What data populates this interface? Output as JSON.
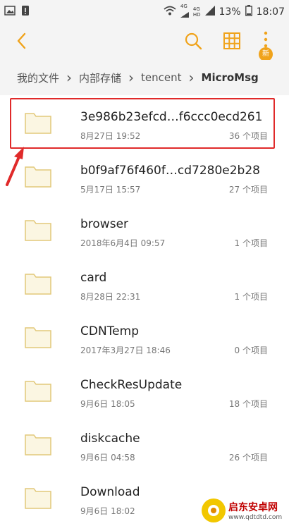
{
  "statusbar": {
    "net_type": "4G",
    "net_sub1": "4G",
    "net_sub2": "HD",
    "battery": "13%",
    "time": "18:07"
  },
  "appbar": {
    "new_badge": "新",
    "accent": "#f0a31b"
  },
  "breadcrumb": {
    "items": [
      "我的文件",
      "内部存储",
      "tencent",
      "MicroMsg"
    ]
  },
  "folders": [
    {
      "name": "3e986b23efcd…f6ccc0ecd261",
      "date": "8月27日 19:52",
      "count": "36 个项目"
    },
    {
      "name": "b0f9af76f460f…cd7280e2b28",
      "date": "5月17日 15:57",
      "count": "27 个项目"
    },
    {
      "name": "browser",
      "date": "2018年6月4日 09:57",
      "count": "1 个项目"
    },
    {
      "name": "card",
      "date": "8月28日 22:31",
      "count": "1 个项目"
    },
    {
      "name": "CDNTemp",
      "date": "2017年3月27日 18:46",
      "count": "0 个项目"
    },
    {
      "name": "CheckResUpdate",
      "date": "9月6日 18:05",
      "count": "18 个项目"
    },
    {
      "name": "diskcache",
      "date": "9月6日 04:58",
      "count": "26 个项目"
    },
    {
      "name": "Download",
      "date": "9月6日 18:02",
      "count": ""
    }
  ],
  "watermark": {
    "title": "启东安卓网",
    "url": "www.qdtdtd.com"
  }
}
